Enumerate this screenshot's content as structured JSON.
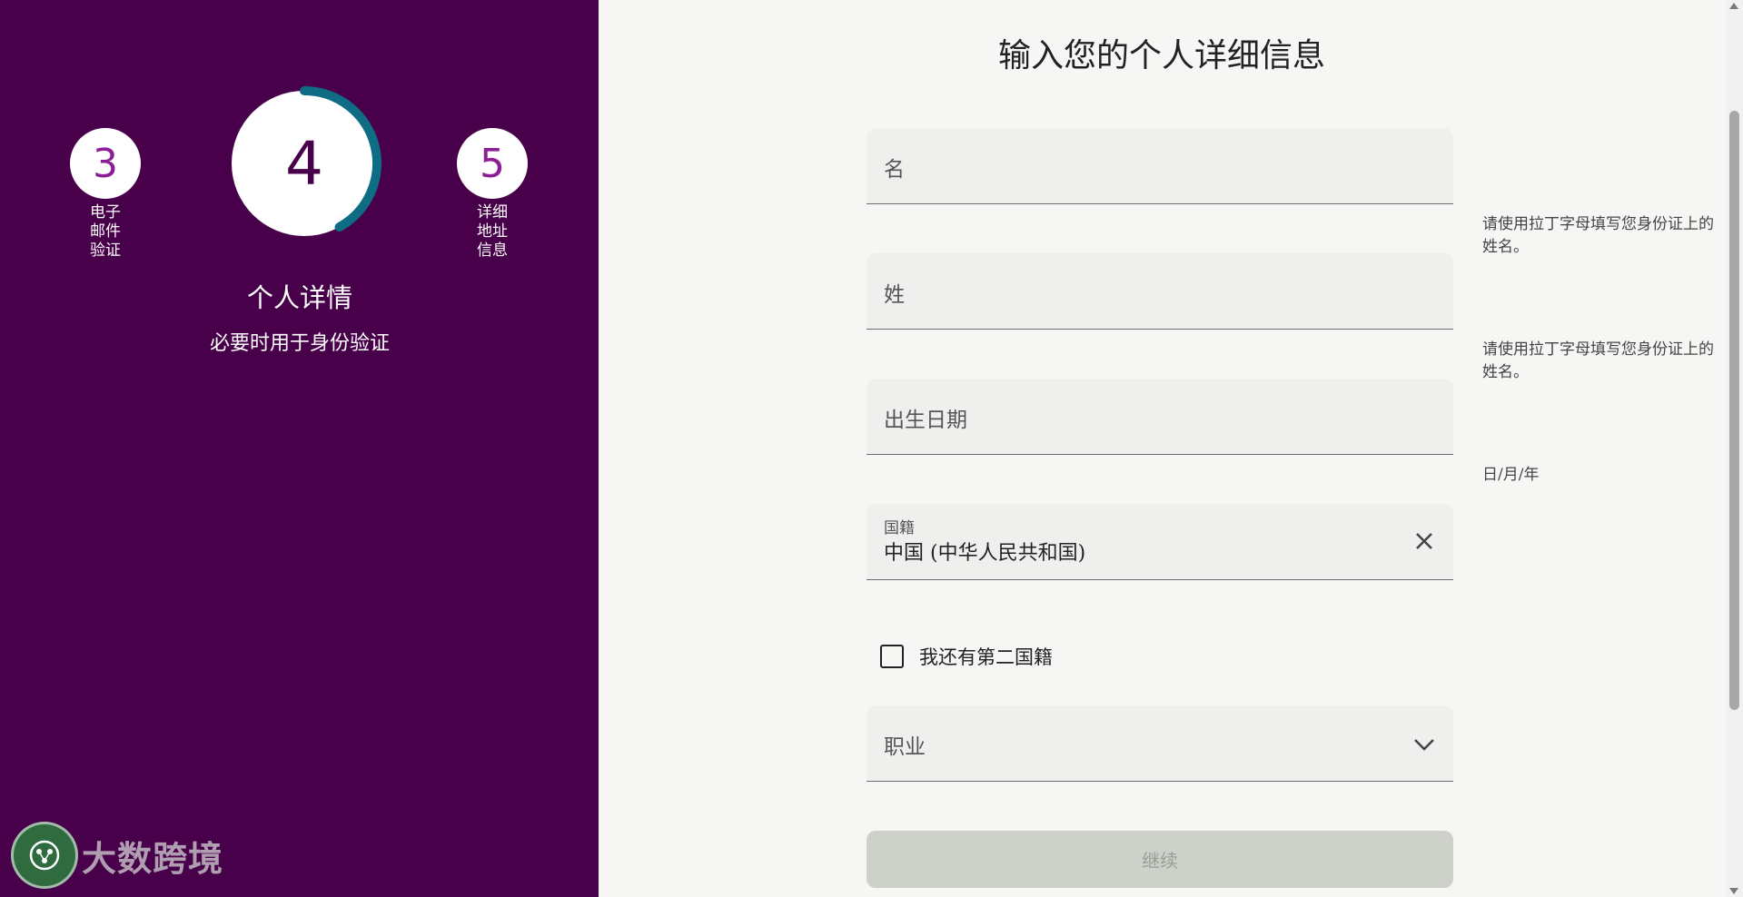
{
  "sidebar": {
    "steps": {
      "prev": {
        "number": "3",
        "label": "电子\n邮件\n验证"
      },
      "current": {
        "number": "4",
        "progress": 0.42
      },
      "next": {
        "number": "5",
        "label": "详细\n地址\n信息"
      }
    },
    "current_title": "个人详情",
    "current_subtitle": "必要时用于身份验证",
    "brand_text": "大数跨境"
  },
  "main": {
    "title": "输入您的个人详细信息",
    "fields": {
      "first_name": {
        "placeholder": "名",
        "hint": "请使用拉丁字母填写您身份证上的姓名。"
      },
      "last_name": {
        "placeholder": "姓",
        "hint": "请使用拉丁字母填写您身份证上的姓名。"
      },
      "dob": {
        "placeholder": "出生日期",
        "hint": "日/月/年"
      },
      "nationality": {
        "label": "国籍",
        "value": "中国 (中华人民共和国)"
      },
      "second_nationality": {
        "label": "我还有第二国籍",
        "checked": false
      },
      "occupation": {
        "placeholder": "职业"
      }
    },
    "continue_label": "继续"
  },
  "colors": {
    "sidebar_bg": "#48004b",
    "progress_arc": "#0e6c85",
    "step_number": "#8c1f96",
    "continue_disabled_bg": "#cdd1c9"
  }
}
